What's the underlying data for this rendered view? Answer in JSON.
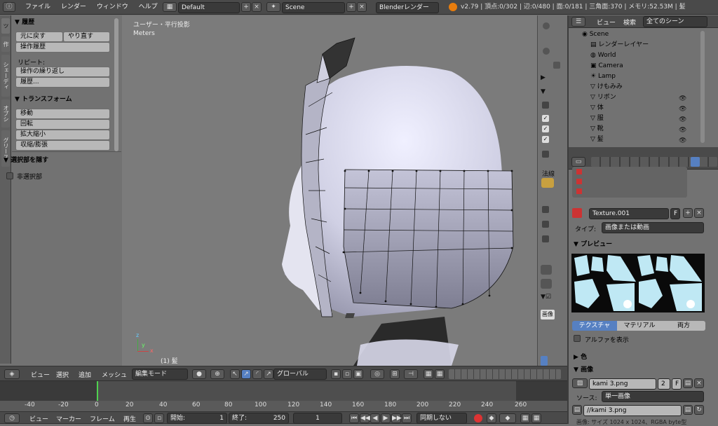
{
  "topbar": {
    "menus": [
      "ファイル",
      "レンダー",
      "ウィンドウ",
      "ヘルプ"
    ],
    "layout": "Default",
    "scene": "Scene",
    "engine": "Blenderレンダー",
    "stats": "v2.79 | 頂点:0/302 | 辺:0/480 | 面:0/181 | 三角面:370 | メモリ:52.53M | 髪"
  },
  "left_tabs": [
    "ツ",
    "作",
    "シェーディ",
    "オプシ",
    "グリース"
  ],
  "toolshelf": {
    "history_title": "履歴",
    "undo": "元に戻す",
    "redo": "やり直す",
    "undo_history": "操作履歴",
    "repeat_label": "リピート:",
    "repeat_last": "操作の繰り返し",
    "repeat_history": "履歴...",
    "transform_title": "トランスフォーム",
    "transform_items": [
      "移動",
      "回転",
      "拡大縮小",
      "収縮/膨張"
    ],
    "hide_title": "選択部を隠す",
    "unselected": "非選択部"
  },
  "viewport": {
    "view_name": "ユーザー・平行投影",
    "units": "Meters",
    "object_label": "(1) 髪",
    "axis_z": "z",
    "axis_y": "y",
    "axis_x": "x"
  },
  "viewport_header": {
    "menus": [
      "ビュー",
      "選択",
      "追加",
      "メッシュ"
    ],
    "mode": "編集モード",
    "orientation": "グローバル"
  },
  "mid_panel": {
    "normals_label": "法線",
    "image_label": "画像"
  },
  "outliner": {
    "menus": [
      "ビュー",
      "検索"
    ],
    "filter": "全てのシーン",
    "items": [
      {
        "label": "Scene",
        "indent": 0,
        "icon": "scene-icon"
      },
      {
        "label": "レンダーレイヤー",
        "indent": 1,
        "icon": "renderlayer-icon"
      },
      {
        "label": "World",
        "indent": 1,
        "icon": "world-icon"
      },
      {
        "label": "Camera",
        "indent": 1,
        "icon": "camera-icon"
      },
      {
        "label": "Lamp",
        "indent": 1,
        "icon": "lamp-icon"
      },
      {
        "label": "けもみみ",
        "indent": 1,
        "icon": "mesh-icon"
      },
      {
        "label": "リボン",
        "indent": 1,
        "icon": "mesh-icon"
      },
      {
        "label": "体",
        "indent": 1,
        "icon": "mesh-icon"
      },
      {
        "label": "服",
        "indent": 1,
        "icon": "mesh-icon"
      },
      {
        "label": "靴",
        "indent": 1,
        "icon": "mesh-icon"
      },
      {
        "label": "髪",
        "indent": 1,
        "icon": "mesh-icon"
      }
    ]
  },
  "properties": {
    "texture_name": "Texture.001",
    "f_label": "F",
    "type_label": "タイプ:",
    "type_value": "画像または動画",
    "preview_title": "プレビュー",
    "preview_tabs": [
      "テクスチャ",
      "マテリアル",
      "両方"
    ],
    "show_alpha": "アルファを表示",
    "color_title": "色",
    "image_title": "画像",
    "image_name": "kami 3.png",
    "image_users": "2",
    "source_label": "ソース:",
    "source_value": "単一画像",
    "file_path": "//kami 3.png",
    "footer": "画像: サイズ 1024 x 1024、RGBA byte型"
  },
  "timeline": {
    "ruler": [
      "-40",
      "-20",
      "0",
      "20",
      "40",
      "60",
      "80",
      "100",
      "120",
      "140",
      "160",
      "180",
      "200",
      "220",
      "240",
      "260"
    ],
    "menus": [
      "ビュー",
      "マーカー",
      "フレーム",
      "再生"
    ],
    "start_label": "開始:",
    "start_value": "1",
    "end_label": "終了:",
    "end_value": "250",
    "current": "1",
    "sync": "同期しない"
  },
  "colors": {
    "accent": "#5680c2",
    "header": "#4a4a4a",
    "panel": "#727272",
    "viewport": "#7b7b7b",
    "timeline": "#4e4e4e"
  }
}
